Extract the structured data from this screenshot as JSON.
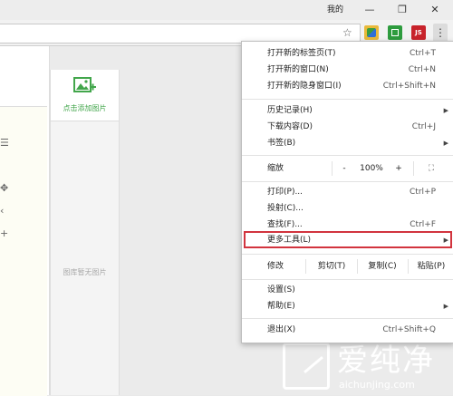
{
  "titlebar": {
    "user_badge": "我的",
    "minimize_glyph": "—",
    "restore_glyph": "❐",
    "close_glyph": "✕"
  },
  "toolbar": {
    "star_glyph": "☆",
    "ext_label": "JS",
    "menu_glyph": "⋮"
  },
  "page": {
    "add_image_label": "点击添加图片",
    "empty_label": "图库暂无图片",
    "side_glyphs": [
      "☰",
      "✥",
      "‹",
      "+"
    ]
  },
  "menu": {
    "items": [
      {
        "label": "打开新的标签页(T)",
        "shortcut": "Ctrl+T"
      },
      {
        "label": "打开新的窗口(N)",
        "shortcut": "Ctrl+N"
      },
      {
        "label": "打开新的隐身窗口(I)",
        "shortcut": "Ctrl+Shift+N"
      },
      {
        "label": "历史记录(H)",
        "submenu": "▶"
      },
      {
        "label": "下载内容(D)",
        "shortcut": "Ctrl+J"
      },
      {
        "label": "书签(B)",
        "submenu": "▶"
      },
      {
        "label": "打印(P)...",
        "shortcut": "Ctrl+P"
      },
      {
        "label": "投射(C)..."
      },
      {
        "label": "查找(F)...",
        "shortcut": "Ctrl+F"
      },
      {
        "label": "更多工具(L)",
        "submenu": "▶"
      },
      {
        "label": "设置(S)"
      },
      {
        "label": "帮助(E)",
        "submenu": "▶"
      },
      {
        "label": "退出(X)",
        "shortcut": "Ctrl+Shift+Q"
      }
    ],
    "zoom": {
      "label": "缩放",
      "minus": "-",
      "value": "100%",
      "plus": "+",
      "fullscreen": "⛶"
    },
    "edit": {
      "label": "修改",
      "cut": "剪切(T)",
      "copy": "复制(C)",
      "paste": "粘贴(P)"
    }
  },
  "watermark": {
    "brand": "爱纯净",
    "url": "aichunjing.com"
  }
}
